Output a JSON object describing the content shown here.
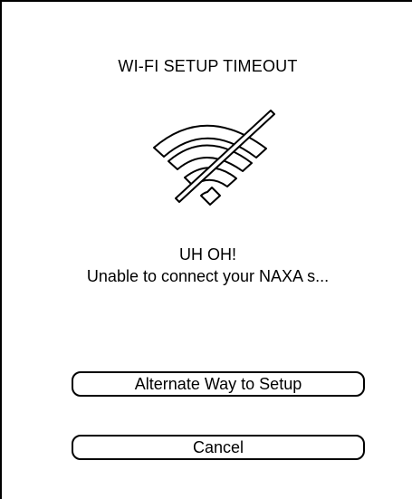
{
  "dialog": {
    "title": "WI-FI SETUP TIMEOUT",
    "icon": "wifi-off-icon",
    "heading": "UH OH!",
    "message": "Unable to connect your NAXA s..."
  },
  "buttons": {
    "alternate_label": "Alternate Way to Setup",
    "cancel_label": "Cancel"
  },
  "colors": {
    "background": "#ffffff",
    "foreground": "#000000"
  }
}
